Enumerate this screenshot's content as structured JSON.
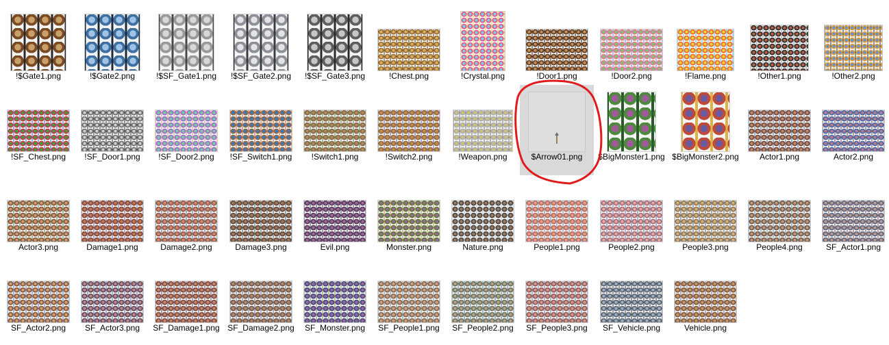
{
  "view": "large-icons",
  "selected_item": "$Arrow01.png",
  "annotation_color": "#e01b1b",
  "files": [
    {
      "name": "!$Gate1.png",
      "icon": "gate-sheet-icon",
      "palette": [
        "#7a4a22",
        "#c9a06a",
        "#2a2a2a"
      ]
    },
    {
      "name": "!$Gate2.png",
      "icon": "gate-sheet-icon",
      "palette": [
        "#3f6fa0",
        "#9ec3e6",
        "#1b2b3d"
      ]
    },
    {
      "name": "!$SF_Gate1.png",
      "icon": "gate-sheet-icon",
      "palette": [
        "#9a9a9a",
        "#d8d8d8",
        "#4a4a4a"
      ]
    },
    {
      "name": "!$SF_Gate2.png",
      "icon": "gate-sheet-icon",
      "palette": [
        "#8d9096",
        "#e1e3e6",
        "#3a3c40"
      ]
    },
    {
      "name": "!$SF_Gate3.png",
      "icon": "gate-sheet-icon",
      "palette": [
        "#5e5e5e",
        "#c6c6c6",
        "#2a2a2a"
      ]
    },
    {
      "name": "!Chest.png",
      "icon": "chest-sheet-icon",
      "palette": [
        "#a07030",
        "#d9b060",
        "#5a3a18"
      ]
    },
    {
      "name": "!Crystal.png",
      "icon": "crystal-sheet-icon",
      "palette": [
        "#e05a8a",
        "#7ad0f0",
        "#f0d050"
      ]
    },
    {
      "name": "!Door1.png",
      "icon": "door-sheet-icon",
      "palette": [
        "#6a4020",
        "#c09060",
        "#2a1a10"
      ]
    },
    {
      "name": "!Door2.png",
      "icon": "door-sheet-icon",
      "palette": [
        "#e08080",
        "#80c080",
        "#8080e0"
      ]
    },
    {
      "name": "!Flame.png",
      "icon": "flame-sheet-icon",
      "palette": [
        "#f07020",
        "#f0d040",
        "#60c0f0"
      ]
    },
    {
      "name": "!Other1.png",
      "icon": "object-sheet-icon",
      "palette": [
        "#303030",
        "#c06040",
        "#909090"
      ]
    },
    {
      "name": "!Other2.png",
      "icon": "object-sheet-icon",
      "palette": [
        "#e0a040",
        "#6090d0",
        "#303030"
      ]
    },
    {
      "name": "!SF_Chest.png",
      "icon": "chest-sheet-icon",
      "palette": [
        "#c04040",
        "#40a040",
        "#4060c0"
      ]
    },
    {
      "name": "!SF_Door1.png",
      "icon": "door-sheet-icon",
      "palette": [
        "#707070",
        "#d0d0d0",
        "#303030"
      ]
    },
    {
      "name": "!SF_Door2.png",
      "icon": "door-sheet-icon",
      "palette": [
        "#a070d0",
        "#70d0a0",
        "#d0a070"
      ]
    },
    {
      "name": "!SF_Switch1.png",
      "icon": "switch-sheet-icon",
      "palette": [
        "#8a6a4a",
        "#3a7ac0",
        "#c05a3a"
      ]
    },
    {
      "name": "!Switch1.png",
      "icon": "switch-sheet-icon",
      "palette": [
        "#8a6a4a",
        "#b08a5a",
        "#4a7a3a"
      ]
    },
    {
      "name": "!Switch2.png",
      "icon": "switch-sheet-icon",
      "palette": [
        "#9a6a3a",
        "#c0904a",
        "#5a5aa0"
      ]
    },
    {
      "name": "!Weapon.png",
      "icon": "weapon-sheet-icon",
      "palette": [
        "#b0b0b0",
        "#d0c070",
        "#707070"
      ]
    },
    {
      "name": "$Arrow01.png",
      "icon": "arrow-sprite-icon",
      "palette": [
        "#dcdcdc",
        "#c8a060",
        "#808080"
      ]
    },
    {
      "name": "$BigMonster1.png",
      "icon": "monster-sheet-icon",
      "palette": [
        "#4a8a3a",
        "#a05a9a",
        "#2a5a2a"
      ]
    },
    {
      "name": "$BigMonster2.png",
      "icon": "monster-sheet-icon",
      "palette": [
        "#c04a3a",
        "#6a5aa0",
        "#e0b040"
      ]
    },
    {
      "name": "Actor1.png",
      "icon": "character-sheet-icon",
      "palette": [
        "#7a4a3a",
        "#c08a6a",
        "#4a6a9a"
      ]
    },
    {
      "name": "Actor2.png",
      "icon": "character-sheet-icon",
      "palette": [
        "#4a6ab0",
        "#c07a8a",
        "#6a4a3a"
      ]
    },
    {
      "name": "Actor3.png",
      "icon": "character-sheet-icon",
      "palette": [
        "#8a5a3a",
        "#d09a7a",
        "#5a7a4a"
      ]
    },
    {
      "name": "Damage1.png",
      "icon": "character-sheet-icon",
      "palette": [
        "#8a4a3a",
        "#c07a5a",
        "#6a5a8a"
      ]
    },
    {
      "name": "Damage2.png",
      "icon": "character-sheet-icon",
      "palette": [
        "#9a5a4a",
        "#d08a6a",
        "#4a6a8a"
      ]
    },
    {
      "name": "Damage3.png",
      "icon": "character-sheet-icon",
      "palette": [
        "#6a4a3a",
        "#a07a5a",
        "#3a5a6a"
      ]
    },
    {
      "name": "Evil.png",
      "icon": "character-sheet-icon",
      "palette": [
        "#5a3a6a",
        "#a06a8a",
        "#3a3a3a"
      ]
    },
    {
      "name": "Monster.png",
      "icon": "character-sheet-icon",
      "palette": [
        "#5a7a3a",
        "#9a6aa0",
        "#c07a4a"
      ]
    },
    {
      "name": "Nature.png",
      "icon": "character-sheet-icon",
      "palette": [
        "#4a4a4a",
        "#a07a5a",
        "#c0c0c0"
      ]
    },
    {
      "name": "People1.png",
      "icon": "character-sheet-icon",
      "palette": [
        "#c06a5a",
        "#e0a08a",
        "#6a8ab0"
      ]
    },
    {
      "name": "People2.png",
      "icon": "character-sheet-icon",
      "palette": [
        "#b06a7a",
        "#e0b09a",
        "#5a7a9a"
      ]
    },
    {
      "name": "People3.png",
      "icon": "character-sheet-icon",
      "palette": [
        "#9a7a4a",
        "#d0b08a",
        "#4a6a8a"
      ]
    },
    {
      "name": "People4.png",
      "icon": "character-sheet-icon",
      "palette": [
        "#7a5a4a",
        "#c09a7a",
        "#5a8a9a"
      ]
    },
    {
      "name": "SF_Actor1.png",
      "icon": "character-sheet-icon",
      "palette": [
        "#5a6a8a",
        "#c09a8a",
        "#8a4a3a"
      ]
    },
    {
      "name": "SF_Actor2.png",
      "icon": "character-sheet-icon",
      "palette": [
        "#8a5a3a",
        "#d0a07a",
        "#5a7ab0"
      ]
    },
    {
      "name": "SF_Actor3.png",
      "icon": "character-sheet-icon",
      "palette": [
        "#6a4a5a",
        "#c08a8a",
        "#4a6a9a"
      ]
    },
    {
      "name": "SF_Damage1.png",
      "icon": "character-sheet-icon",
      "palette": [
        "#8a4a3a",
        "#c08a6a",
        "#4a4a7a"
      ]
    },
    {
      "name": "SF_Damage2.png",
      "icon": "character-sheet-icon",
      "palette": [
        "#7a5a4a",
        "#b08a6a",
        "#5a6a8a"
      ]
    },
    {
      "name": "SF_Monster.png",
      "icon": "character-sheet-icon",
      "palette": [
        "#4a4a8a",
        "#9a6a9a",
        "#7a8a4a"
      ]
    },
    {
      "name": "SF_People1.png",
      "icon": "character-sheet-icon",
      "palette": [
        "#8a6a4a",
        "#d0a08a",
        "#6a8aa0"
      ]
    },
    {
      "name": "SF_People2.png",
      "icon": "character-sheet-icon",
      "palette": [
        "#6a7a5a",
        "#c0a08a",
        "#5a6a9a"
      ]
    },
    {
      "name": "SF_People3.png",
      "icon": "character-sheet-icon",
      "palette": [
        "#9a5a5a",
        "#d09a8a",
        "#5a7a8a"
      ]
    },
    {
      "name": "SF_Vehicle.png",
      "icon": "vehicle-sheet-icon",
      "palette": [
        "#5a6a7a",
        "#a0b0c0",
        "#3a3a3a"
      ]
    },
    {
      "name": "Vehicle.png",
      "icon": "vehicle-sheet-icon",
      "palette": [
        "#8a5a3a",
        "#c09a6a",
        "#6a6a8a"
      ]
    }
  ]
}
